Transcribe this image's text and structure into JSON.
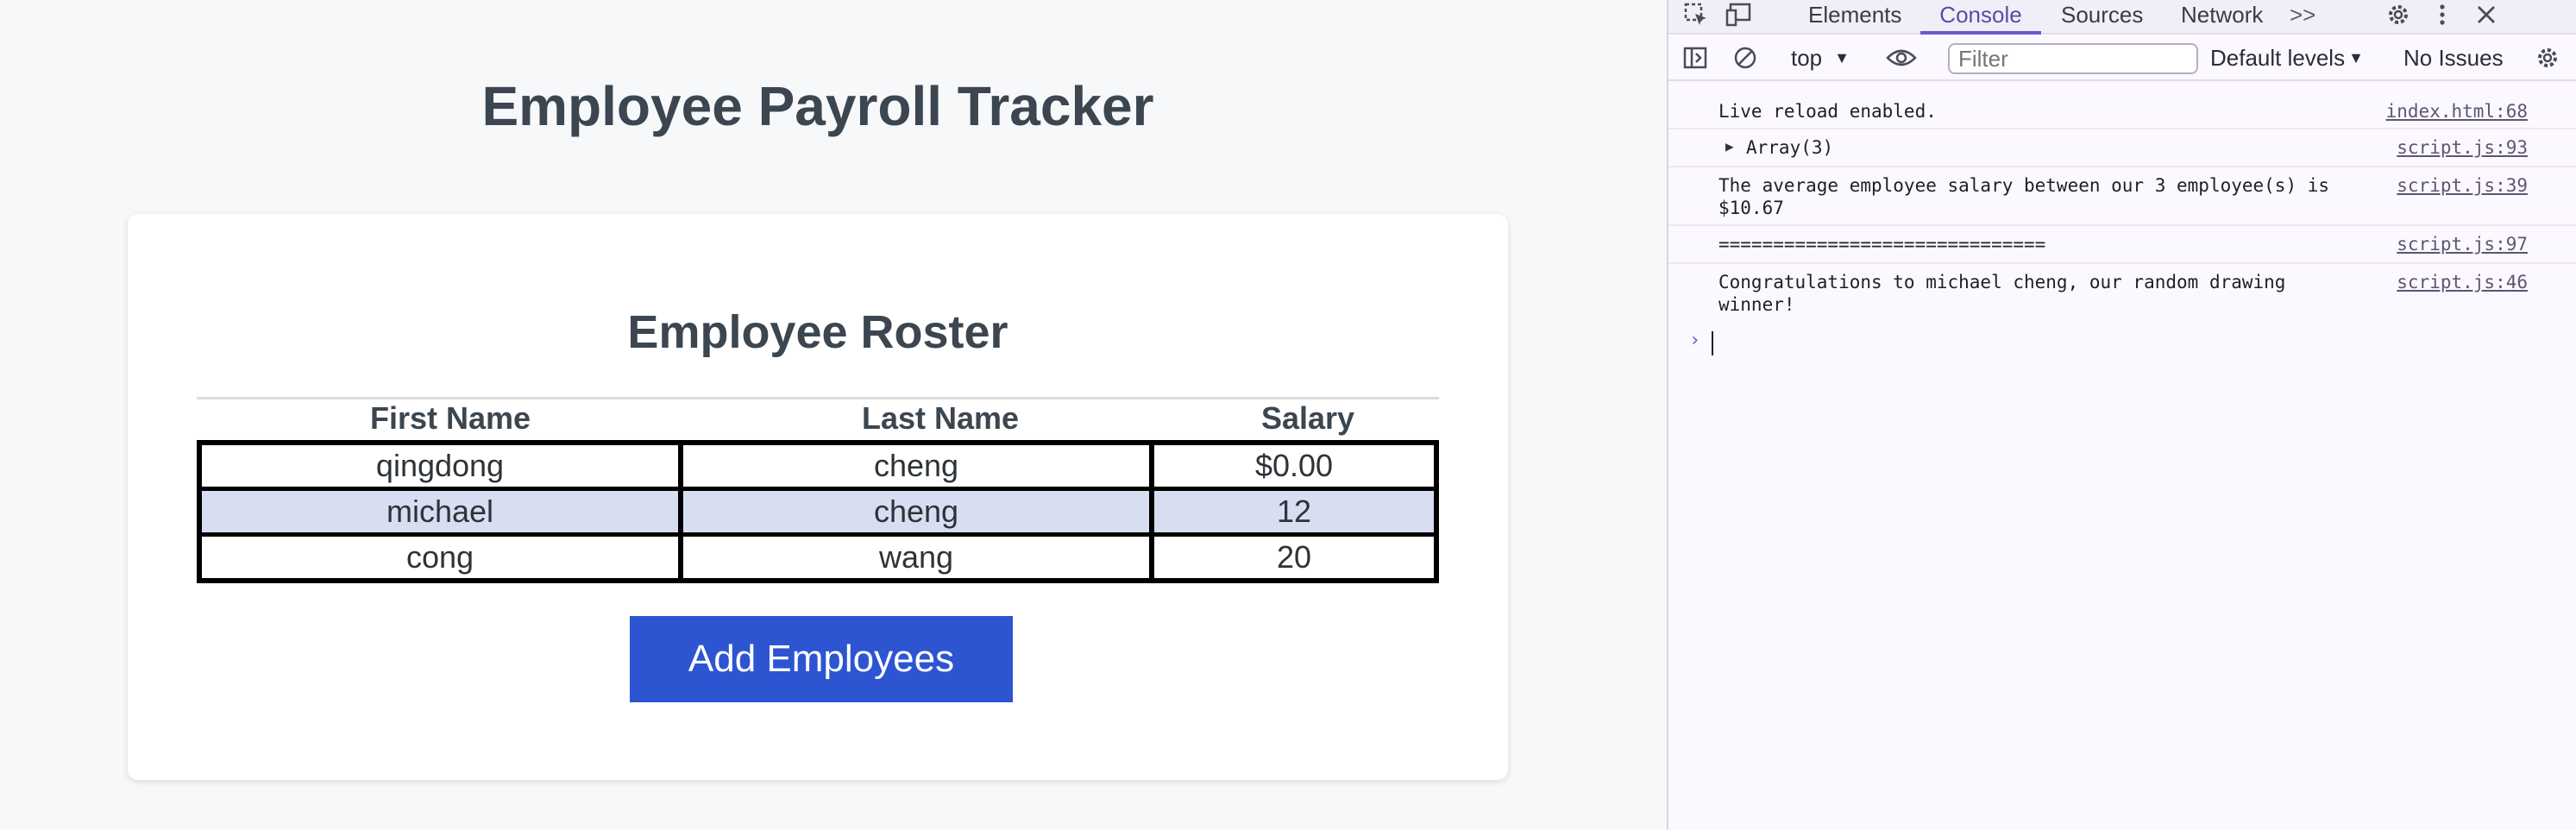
{
  "page": {
    "title": "Employee Payroll Tracker",
    "roster_title": "Employee Roster",
    "columns": [
      "First Name",
      "Last Name",
      "Salary"
    ],
    "rows": [
      [
        "qingdong",
        "cheng",
        "$0.00"
      ],
      [
        "michael",
        "cheng",
        "12"
      ],
      [
        "cong",
        "wang",
        "20"
      ]
    ],
    "add_button": "Add Employees",
    "colors": {
      "accent": "#2d55d2",
      "alt_row": "#d8def2",
      "title": "#3c4650"
    }
  },
  "devtools": {
    "tabs": [
      "Elements",
      "Console",
      "Sources",
      "Network"
    ],
    "active_tab": "Console",
    "more_icon": ">>",
    "context": "top",
    "filter_placeholder": "Filter",
    "levels": "Default levels",
    "issues": "No Issues",
    "console": [
      {
        "text": "Live reload enabled.",
        "source": "index.html:68"
      },
      {
        "text": "Array(3)",
        "source": "script.js:93",
        "expandable": true
      },
      {
        "text": "The average employee salary between our 3 employee(s) is\n$10.67",
        "source": "script.js:39"
      },
      {
        "text": "==============================",
        "source": "script.js:97"
      },
      {
        "text": "Congratulations to michael cheng, our random drawing\nwinner!",
        "source": "script.js:46"
      }
    ],
    "prompt": "›"
  }
}
